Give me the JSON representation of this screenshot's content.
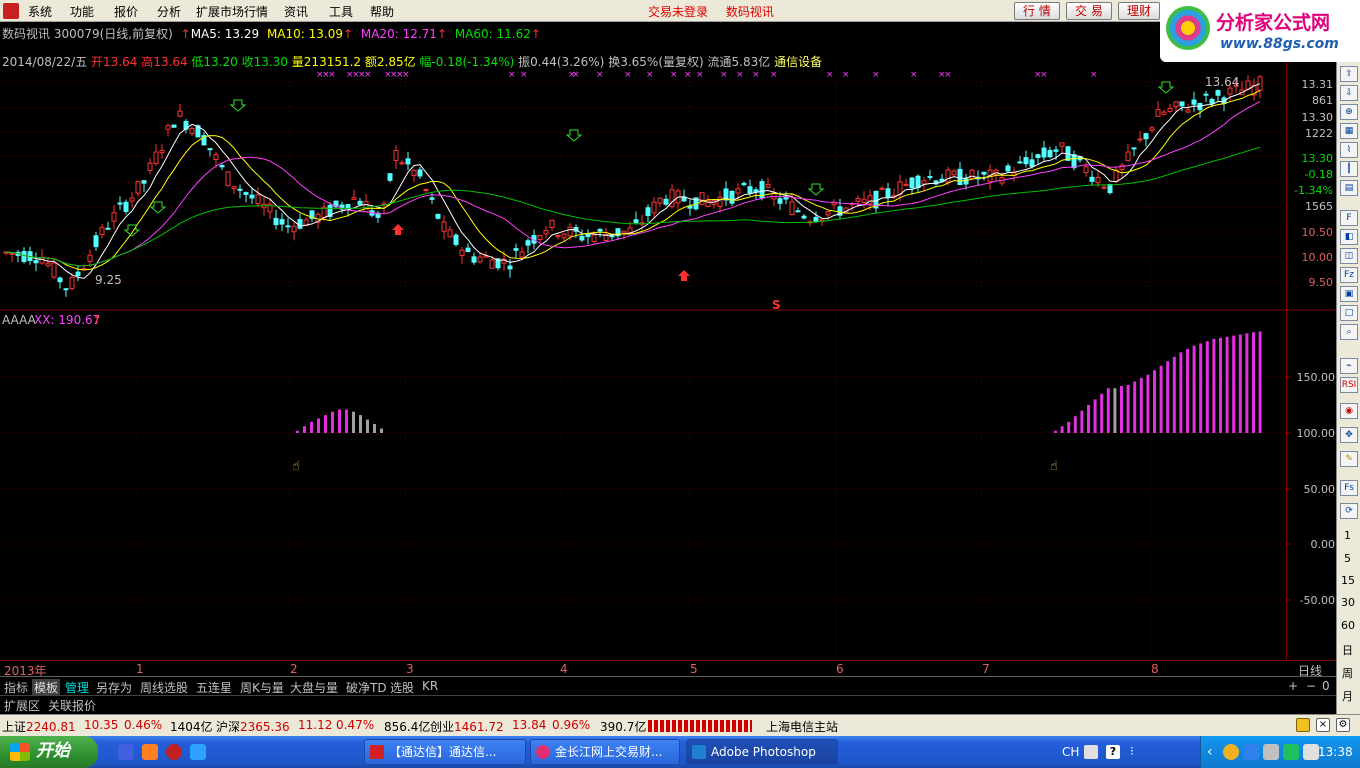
{
  "menu": {
    "items": [
      "系统",
      "功能",
      "报价",
      "分析",
      "扩展市场行情",
      "资讯",
      "工具",
      "帮助"
    ],
    "status_left": "交易未登录",
    "status_right": "数码视讯",
    "buttons": [
      "行 情",
      "交 易",
      "理财"
    ]
  },
  "logo": {
    "title": "分析家公式网",
    "url": "www.88gs.com"
  },
  "info_line1": {
    "stock": "数码视讯 300079(日线,前复权)",
    "ma5": "MA5: 13.29",
    "ma10": "MA10: 13.09",
    "ma20": "MA20: 12.71",
    "ma60": "MA60: 11.62"
  },
  "info_line2": {
    "date": "2014/08/22/五",
    "open": "开13.64",
    "high": "高13.64",
    "low": "低13.20",
    "close": "收13.30",
    "volume": "量213151.2",
    "amount": "额2.85亿",
    "change": "幅-0.18(-1.34%)",
    "amplitude": "振0.44(3.26%)",
    "turnover": "换3.65%(量复权)",
    "float": "流通5.83亿",
    "sector": "通信设备"
  },
  "price_axis": {
    "labels": [
      "13.31",
      "861",
      "13.30",
      "1222",
      "13.30",
      "-0.18",
      "-1.34%",
      "1565",
      "10.50",
      "10.00",
      "9.50"
    ]
  },
  "indicator": {
    "name": "AAAA",
    "value": "XX: 190.67",
    "axis_labels": [
      "150.00",
      "100.00",
      "50.00",
      "0.00",
      "-50.00"
    ]
  },
  "chart_annotations": {
    "high_label": "13.64",
    "low_label": "9.25",
    "s_mark": "S"
  },
  "time_axis": {
    "labels": [
      "2013年",
      "1",
      "2",
      "3",
      "4",
      "5",
      "6",
      "7",
      "8"
    ],
    "period": "日线"
  },
  "tabs": [
    "指标",
    "模板",
    "管理",
    "另存为",
    "周线选股",
    "五连星",
    "周K与量",
    "大盘与量",
    "破净TD",
    "选股",
    "KR"
  ],
  "extra_tabs": [
    "扩展区",
    "关联报价"
  ],
  "right_toolbar": [
    "1",
    "5",
    "15",
    "30",
    "60",
    "日",
    "周",
    "月"
  ],
  "index_strip": {
    "sh_name": "上证",
    "sh_val": "2240.81",
    "sh_chg": "10.35",
    "sh_pct": "0.46%",
    "sh_amt": "1404亿",
    "sz_name": "沪深",
    "sz_val": "2365.36",
    "sz_chg": "11.12",
    "sz_pct": "0.47%",
    "sz_amt": "856.4亿",
    "cy_name": "创业",
    "cy_val": "1461.72",
    "cy_chg": "13.84",
    "cy_pct": "0.96%",
    "cy_amt": "390.7亿",
    "server": "上海电信主站"
  },
  "taskbar": {
    "start": "开始",
    "tasks": [
      "【通达信】通达信...",
      "金长江网上交易财...",
      "Adobe Photoshop"
    ],
    "lang": "CH",
    "time": "13:38"
  },
  "colors": {
    "up": "#ff3232",
    "down": "#54ffff",
    "ma5": "#ffffff",
    "ma10": "#ffff00",
    "ma20": "#ff40ff",
    "ma60": "#00c000",
    "xx_bar": "#e030e0",
    "gray_bar": "#a0a0a0"
  },
  "chart_data": {
    "type": "candlestick",
    "ylim": [
      9.25,
      13.64
    ],
    "indicator_ylim": [
      -50,
      190.67
    ],
    "series": [
      {
        "name": "MA5",
        "values": []
      },
      {
        "name": "MA10",
        "values": []
      },
      {
        "name": "MA20",
        "values": []
      },
      {
        "name": "MA60",
        "values": []
      }
    ]
  }
}
